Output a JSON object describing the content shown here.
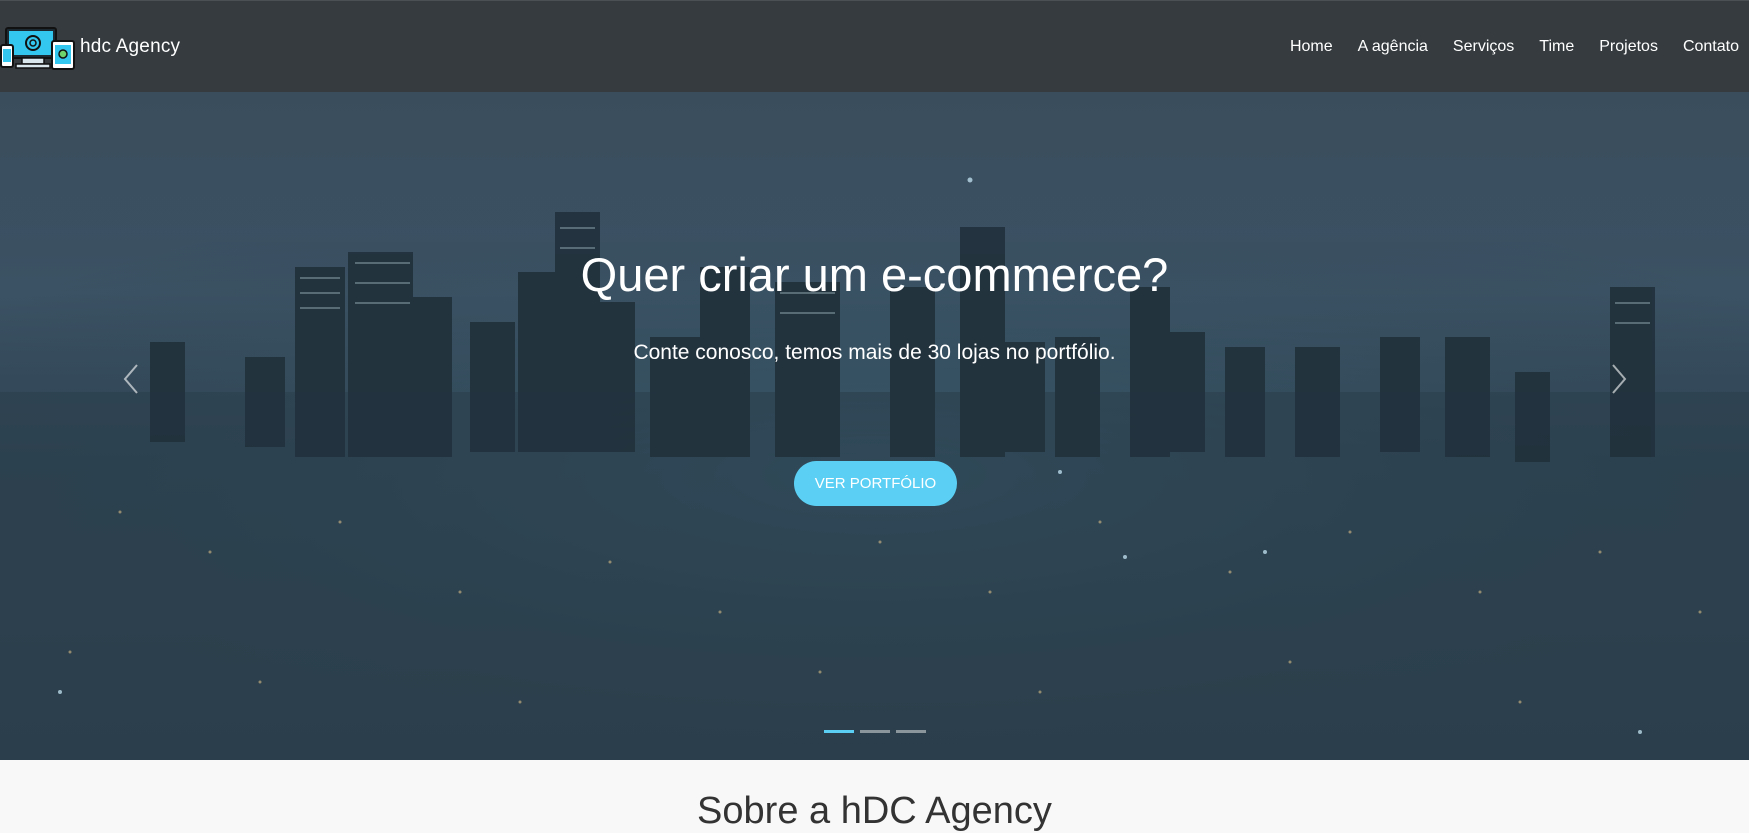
{
  "navbar": {
    "brand": "hdc Agency",
    "logo_icon": "devices-logo-icon",
    "links": [
      "Home",
      "A agência",
      "Serviços",
      "Time",
      "Projetos",
      "Contato"
    ]
  },
  "hero": {
    "title": "Quer criar um e-commerce?",
    "subtitle": "Conte conosco, temos mais de 30 lojas no portfólio.",
    "cta": "VER PORTFÓLIO",
    "slides": 3,
    "active_slide": 1
  },
  "about": {
    "title": "Sobre a hDC Agency"
  },
  "colors": {
    "navbar": "#353b3f",
    "accent": "#5bd0f4",
    "section_bg": "#f8f8f8"
  }
}
